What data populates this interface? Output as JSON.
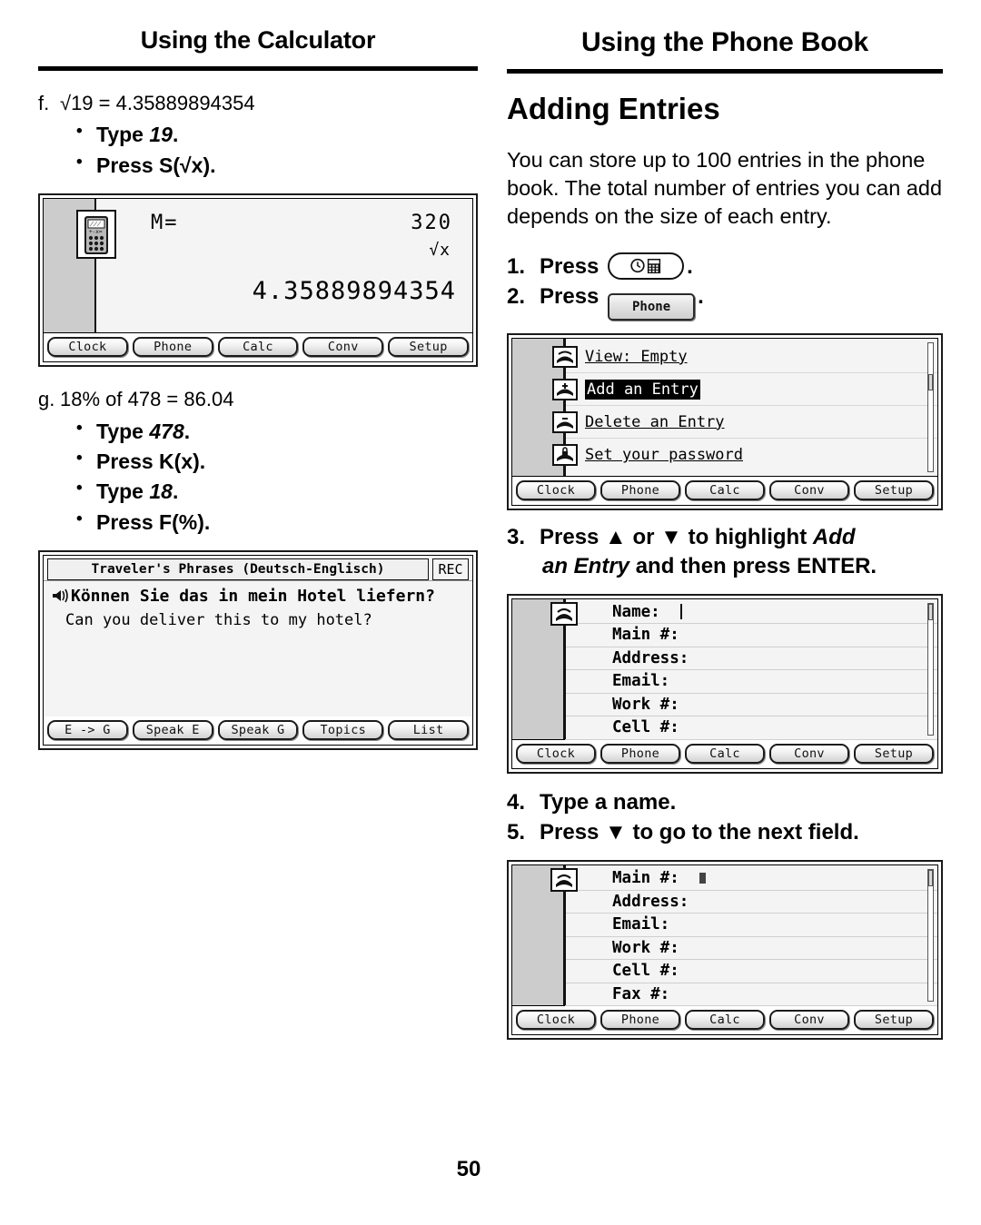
{
  "page": {
    "number": "50",
    "left_header": "Using the Calculator",
    "right_header": "Using the Phone Book"
  },
  "left_column": {
    "item_f": {
      "letter": "f.",
      "equation": "√19 = 4.35889894354",
      "bullets": [
        {
          "action": "Type ",
          "value": "19",
          "tail": "."
        },
        {
          "action": "Press S(√x).",
          "value": "",
          "tail": ""
        }
      ]
    },
    "calculator_screen": {
      "memory_label": "M=",
      "memory_value": "320",
      "mode_indicator": "√x",
      "result": "4.35889894354",
      "icon": "calculator-icon",
      "softkeys": [
        "Clock",
        "Phone",
        "Calc",
        "Conv",
        "Setup"
      ]
    },
    "item_g": {
      "letter": "g.",
      "equation": "18% of 478 = 86.04",
      "bullets": [
        {
          "action": "Type ",
          "value": "478",
          "tail": "."
        },
        {
          "action": "Press K(x).",
          "value": "",
          "tail": ""
        },
        {
          "action": "Type ",
          "value": "18",
          "tail": "."
        },
        {
          "action": "Press F(%).",
          "value": "",
          "tail": ""
        }
      ]
    },
    "phrases_screen": {
      "title": "Traveler's Phrases (Deutsch-Englisch)",
      "rec_label": "REC",
      "german_phrase": "Können Sie das in mein Hotel liefern?",
      "english_phrase": "Can you deliver this to my hotel?",
      "speaker_icon": "speaker-icon",
      "softkeys": [
        "E -> G",
        "Speak E",
        "Speak G",
        "Topics",
        "List"
      ]
    }
  },
  "right_column": {
    "section_title": "Adding Entries",
    "intro": "You can store up to 100 entries in the phone book. The total number of entries you can add depends on the size of each entry.",
    "steps": [
      {
        "num": "1.",
        "text_before": "Press ",
        "key_type": "pill",
        "key_label": "",
        "text_after": "."
      },
      {
        "num": "2.",
        "text_before": "Press ",
        "key_type": "button",
        "key_label": "Phone",
        "text_after": "."
      },
      {
        "num": "3.",
        "line1": "Press ▲ or ▼ to highlight ",
        "line1_ital": "Add",
        "line2_ital": "an Entry",
        "line2": " and then press ENTER."
      },
      {
        "num": "4.",
        "text": "Type a name."
      },
      {
        "num": "5.",
        "text": "Press ▼ to go to the next field."
      }
    ],
    "menu_screen": {
      "items": [
        {
          "label": "View: Empty",
          "icon": "phone-view-icon",
          "selected": false
        },
        {
          "label": "Add an Entry",
          "icon": "phone-add-icon",
          "selected": true
        },
        {
          "label": "Delete an Entry",
          "icon": "phone-delete-icon",
          "selected": false
        },
        {
          "label": "Set your password",
          "icon": "phone-lock-icon",
          "selected": false
        }
      ],
      "softkeys": [
        "Clock",
        "Phone",
        "Calc",
        "Conv",
        "Setup"
      ]
    },
    "form_screen_1": {
      "fields": [
        "Name:",
        "Main #:",
        "Address:",
        "Email:",
        "Work #:",
        "Cell #:"
      ],
      "cursor_field_index": 0,
      "icon": "phone-entry-icon",
      "softkeys": [
        "Clock",
        "Phone",
        "Calc",
        "Conv",
        "Setup"
      ]
    },
    "form_screen_2": {
      "fields": [
        "Main #:",
        "Address:",
        "Email:",
        "Work #:",
        "Cell #:",
        "Fax #:"
      ],
      "cursor_field_index": 0,
      "icon": "phone-entry-icon",
      "softkeys": [
        "Clock",
        "Phone",
        "Calc",
        "Conv",
        "Setup"
      ]
    }
  }
}
